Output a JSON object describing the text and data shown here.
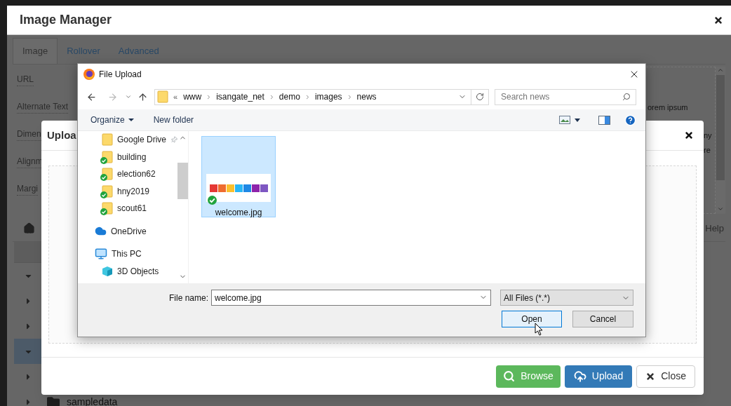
{
  "image_manager": {
    "title": "Image Manager",
    "tabs": [
      {
        "label": "Image",
        "selected": true
      },
      {
        "label": "Rollover",
        "selected": false
      },
      {
        "label": "Advanced",
        "selected": false
      }
    ],
    "fields": [
      "URL",
      "Alternate Text",
      "Dimen",
      "Alignm",
      "Margi"
    ],
    "preview_text": [
      "orem ipsum",
      "ny",
      "re"
    ],
    "help": "Help",
    "tree": [
      {
        "expanded": true,
        "selected": false
      },
      {
        "expanded": false,
        "selected": false
      },
      {
        "expanded": false,
        "selected": false
      },
      {
        "expanded": true,
        "selected": true
      },
      {
        "expanded": false,
        "selected": false
      },
      {
        "expanded": false,
        "selected": false,
        "label": "sampledata"
      }
    ]
  },
  "upload_dialog": {
    "title": "Uploa",
    "buttons": [
      {
        "kind": "browse",
        "label": "Browse"
      },
      {
        "kind": "upload",
        "label": "Upload"
      },
      {
        "kind": "close",
        "label": "Close"
      }
    ]
  },
  "file_dialog": {
    "title": "File Upload",
    "path_prefix": "«",
    "path": [
      "www",
      "isangate_net",
      "demo",
      "images",
      "news"
    ],
    "search": {
      "placeholder": "Search news"
    },
    "toolbar": [
      "Organize",
      "New folder"
    ],
    "nav": [
      {
        "label": "Google Drive",
        "kind": "folder",
        "pinned": true,
        "synced": false
      },
      {
        "label": "building",
        "kind": "folder",
        "pinned": false,
        "synced": true
      },
      {
        "label": "election62",
        "kind": "folder",
        "pinned": false,
        "synced": true
      },
      {
        "label": "hny2019",
        "kind": "folder",
        "pinned": false,
        "synced": true
      },
      {
        "label": "scout61",
        "kind": "folder",
        "pinned": false,
        "synced": true
      },
      {
        "label": "OneDrive",
        "kind": "cloud",
        "pinned": false,
        "synced": false
      },
      {
        "label": "This PC",
        "kind": "pc",
        "pinned": false,
        "synced": false
      },
      {
        "label": "3D Objects",
        "kind": "objects",
        "pinned": false,
        "synced": false
      }
    ],
    "files": [
      {
        "name": "welcome.jpg",
        "selected": true,
        "synced": true
      }
    ],
    "file_name": {
      "label": "File name:",
      "value": "welcome.jpg"
    },
    "filter": "All Files (*.*)",
    "buttons": [
      {
        "label": "Open",
        "focused": true
      },
      {
        "label": "Cancel",
        "focused": false
      }
    ]
  }
}
